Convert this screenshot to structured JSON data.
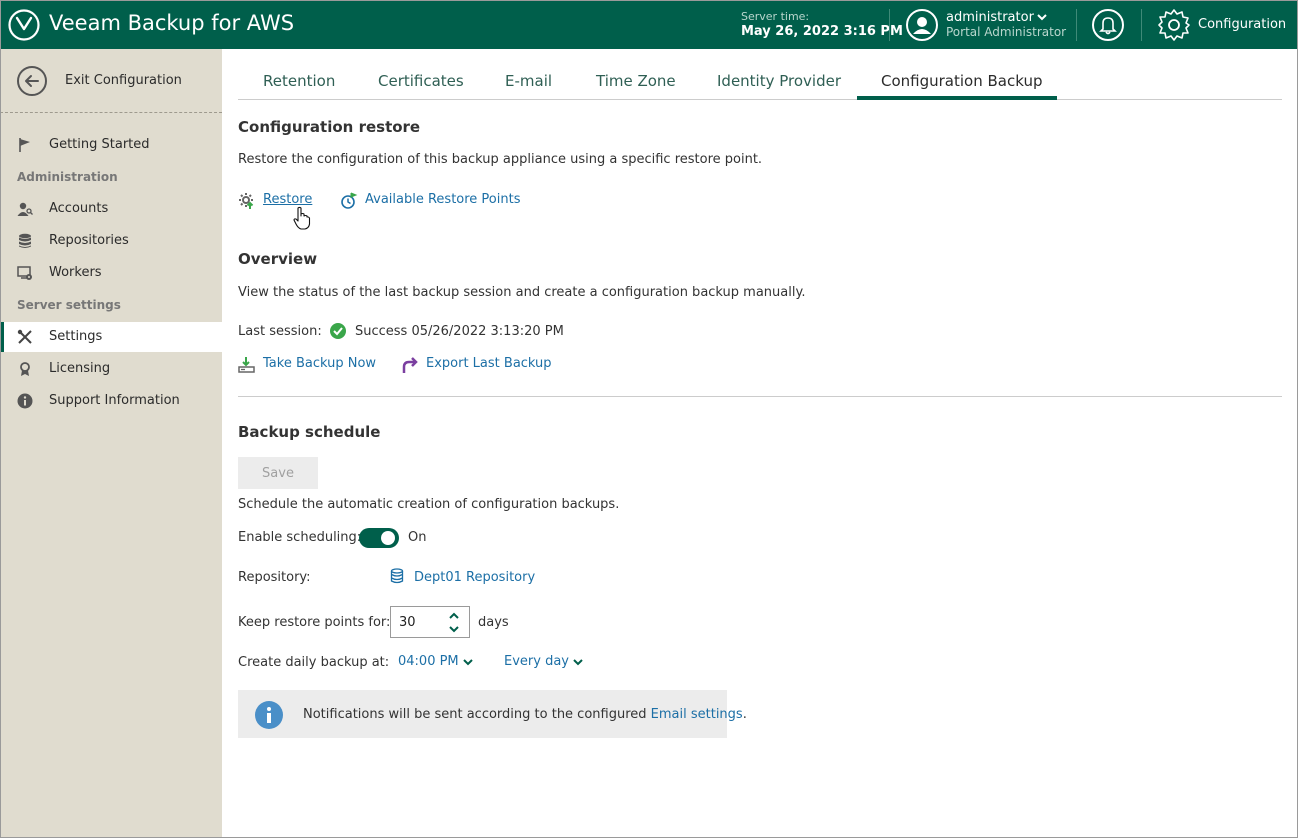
{
  "header": {
    "app_title": "Veeam Backup for AWS",
    "server_time_label": "Server time:",
    "server_time_value": "May 26, 2022 3:16 PM",
    "user_name": "administrator",
    "user_role": "Portal Administrator",
    "config_label": "Configuration"
  },
  "sidebar": {
    "exit_label": "Exit Configuration",
    "getting_started": "Getting Started",
    "section_admin": "Administration",
    "accounts": "Accounts",
    "repositories": "Repositories",
    "workers": "Workers",
    "section_server": "Server settings",
    "settings": "Settings",
    "licensing": "Licensing",
    "support": "Support Information"
  },
  "tabs": {
    "retention": "Retention",
    "certificates": "Certificates",
    "email": "E-mail",
    "timezone": "Time Zone",
    "identity": "Identity Provider",
    "config_backup": "Configuration Backup"
  },
  "restore": {
    "title": "Configuration restore",
    "desc": "Restore the configuration of this backup appliance using a specific restore point.",
    "restore_link": "Restore",
    "points_link": "Available Restore Points"
  },
  "overview": {
    "title": "Overview",
    "desc": "View the status of the last backup session and create a configuration backup manually.",
    "last_session_label": "Last session:",
    "last_session_value": "Success 05/26/2022 3:13:20 PM",
    "take_backup": "Take Backup Now",
    "export_backup": "Export Last Backup"
  },
  "schedule": {
    "title": "Backup schedule",
    "save": "Save",
    "desc": "Schedule the automatic creation of configuration backups.",
    "enable_label": "Enable scheduling:",
    "enable_state": "On",
    "repo_label": "Repository:",
    "repo_value": "Dept01 Repository",
    "keep_label": "Keep restore points for:",
    "keep_value": "30",
    "keep_unit": "days",
    "daily_label": "Create daily backup at:",
    "time_value": "04:00 PM",
    "freq_value": "Every day"
  },
  "info": {
    "text": "Notifications will be sent according to the configured ",
    "link": "Email settings",
    "suffix": "."
  },
  "colors": {
    "brand": "#005f4b",
    "link": "#1c6fa6",
    "sidebar_bg": "#e0dccf",
    "success": "#3aa64a"
  }
}
